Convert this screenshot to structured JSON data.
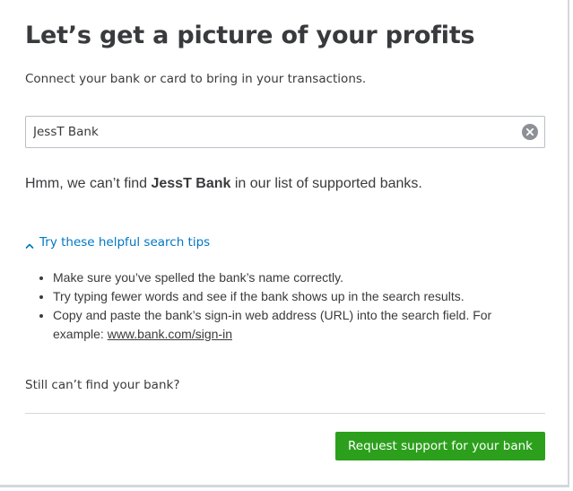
{
  "header": {
    "title": "Let’s get a picture of your profits",
    "subtitle": "Connect your bank or card to bring in your transactions."
  },
  "search": {
    "value": "JessT Bank",
    "clear_icon": "clear-circle-x-icon"
  },
  "results": {
    "message_prefix": "Hmm, we can’t find ",
    "query": "JessT Bank",
    "message_suffix": " in our list of supported banks."
  },
  "tips": {
    "toggle_label": "Try these helpful search tips",
    "toggle_icon": "caret-up-icon",
    "toggle_color": "#0077c5",
    "items": [
      "Make sure you’ve spelled the bank’s name correctly.",
      "Try typing fewer words and see if the bank shows up in the search results.",
      "Copy and paste the bank’s sign-in web address (URL) into the search field. For example: "
    ],
    "example_link": "www.bank.com/sign-in"
  },
  "footer": {
    "still_cant_find": "Still can’t find your bank?",
    "support_button_label": "Request support for your bank",
    "support_button_color": "#2ca01c"
  }
}
